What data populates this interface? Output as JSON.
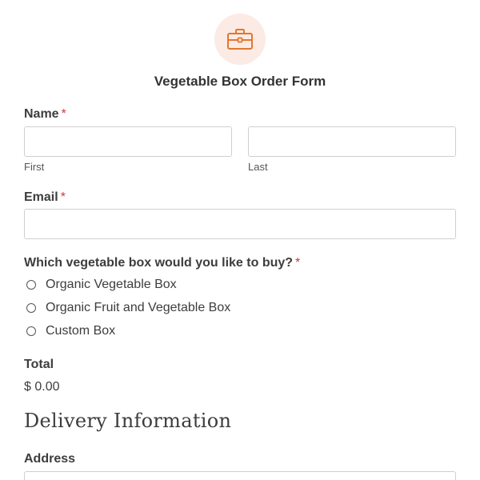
{
  "header": {
    "logo_icon": "briefcase-icon",
    "logo_bg_color": "#fcebe4",
    "logo_icon_color": "#e27730",
    "title": "Vegetable Box Order Form"
  },
  "required_marker": "*",
  "required_color": "#d63637",
  "name_field": {
    "label": "Name",
    "first_value": "",
    "first_sublabel": "First",
    "last_value": "",
    "last_sublabel": "Last"
  },
  "email_field": {
    "label": "Email",
    "value": ""
  },
  "box_choice": {
    "label": "Which vegetable box would you like to buy?",
    "options": [
      "Organic Vegetable Box",
      "Organic Fruit and Vegetable Box",
      "Custom Box"
    ],
    "selected": null
  },
  "total": {
    "label": "Total",
    "value": "$ 0.00"
  },
  "delivery_section": {
    "heading": "Delivery Information",
    "address_label": "Address",
    "address_value": ""
  }
}
